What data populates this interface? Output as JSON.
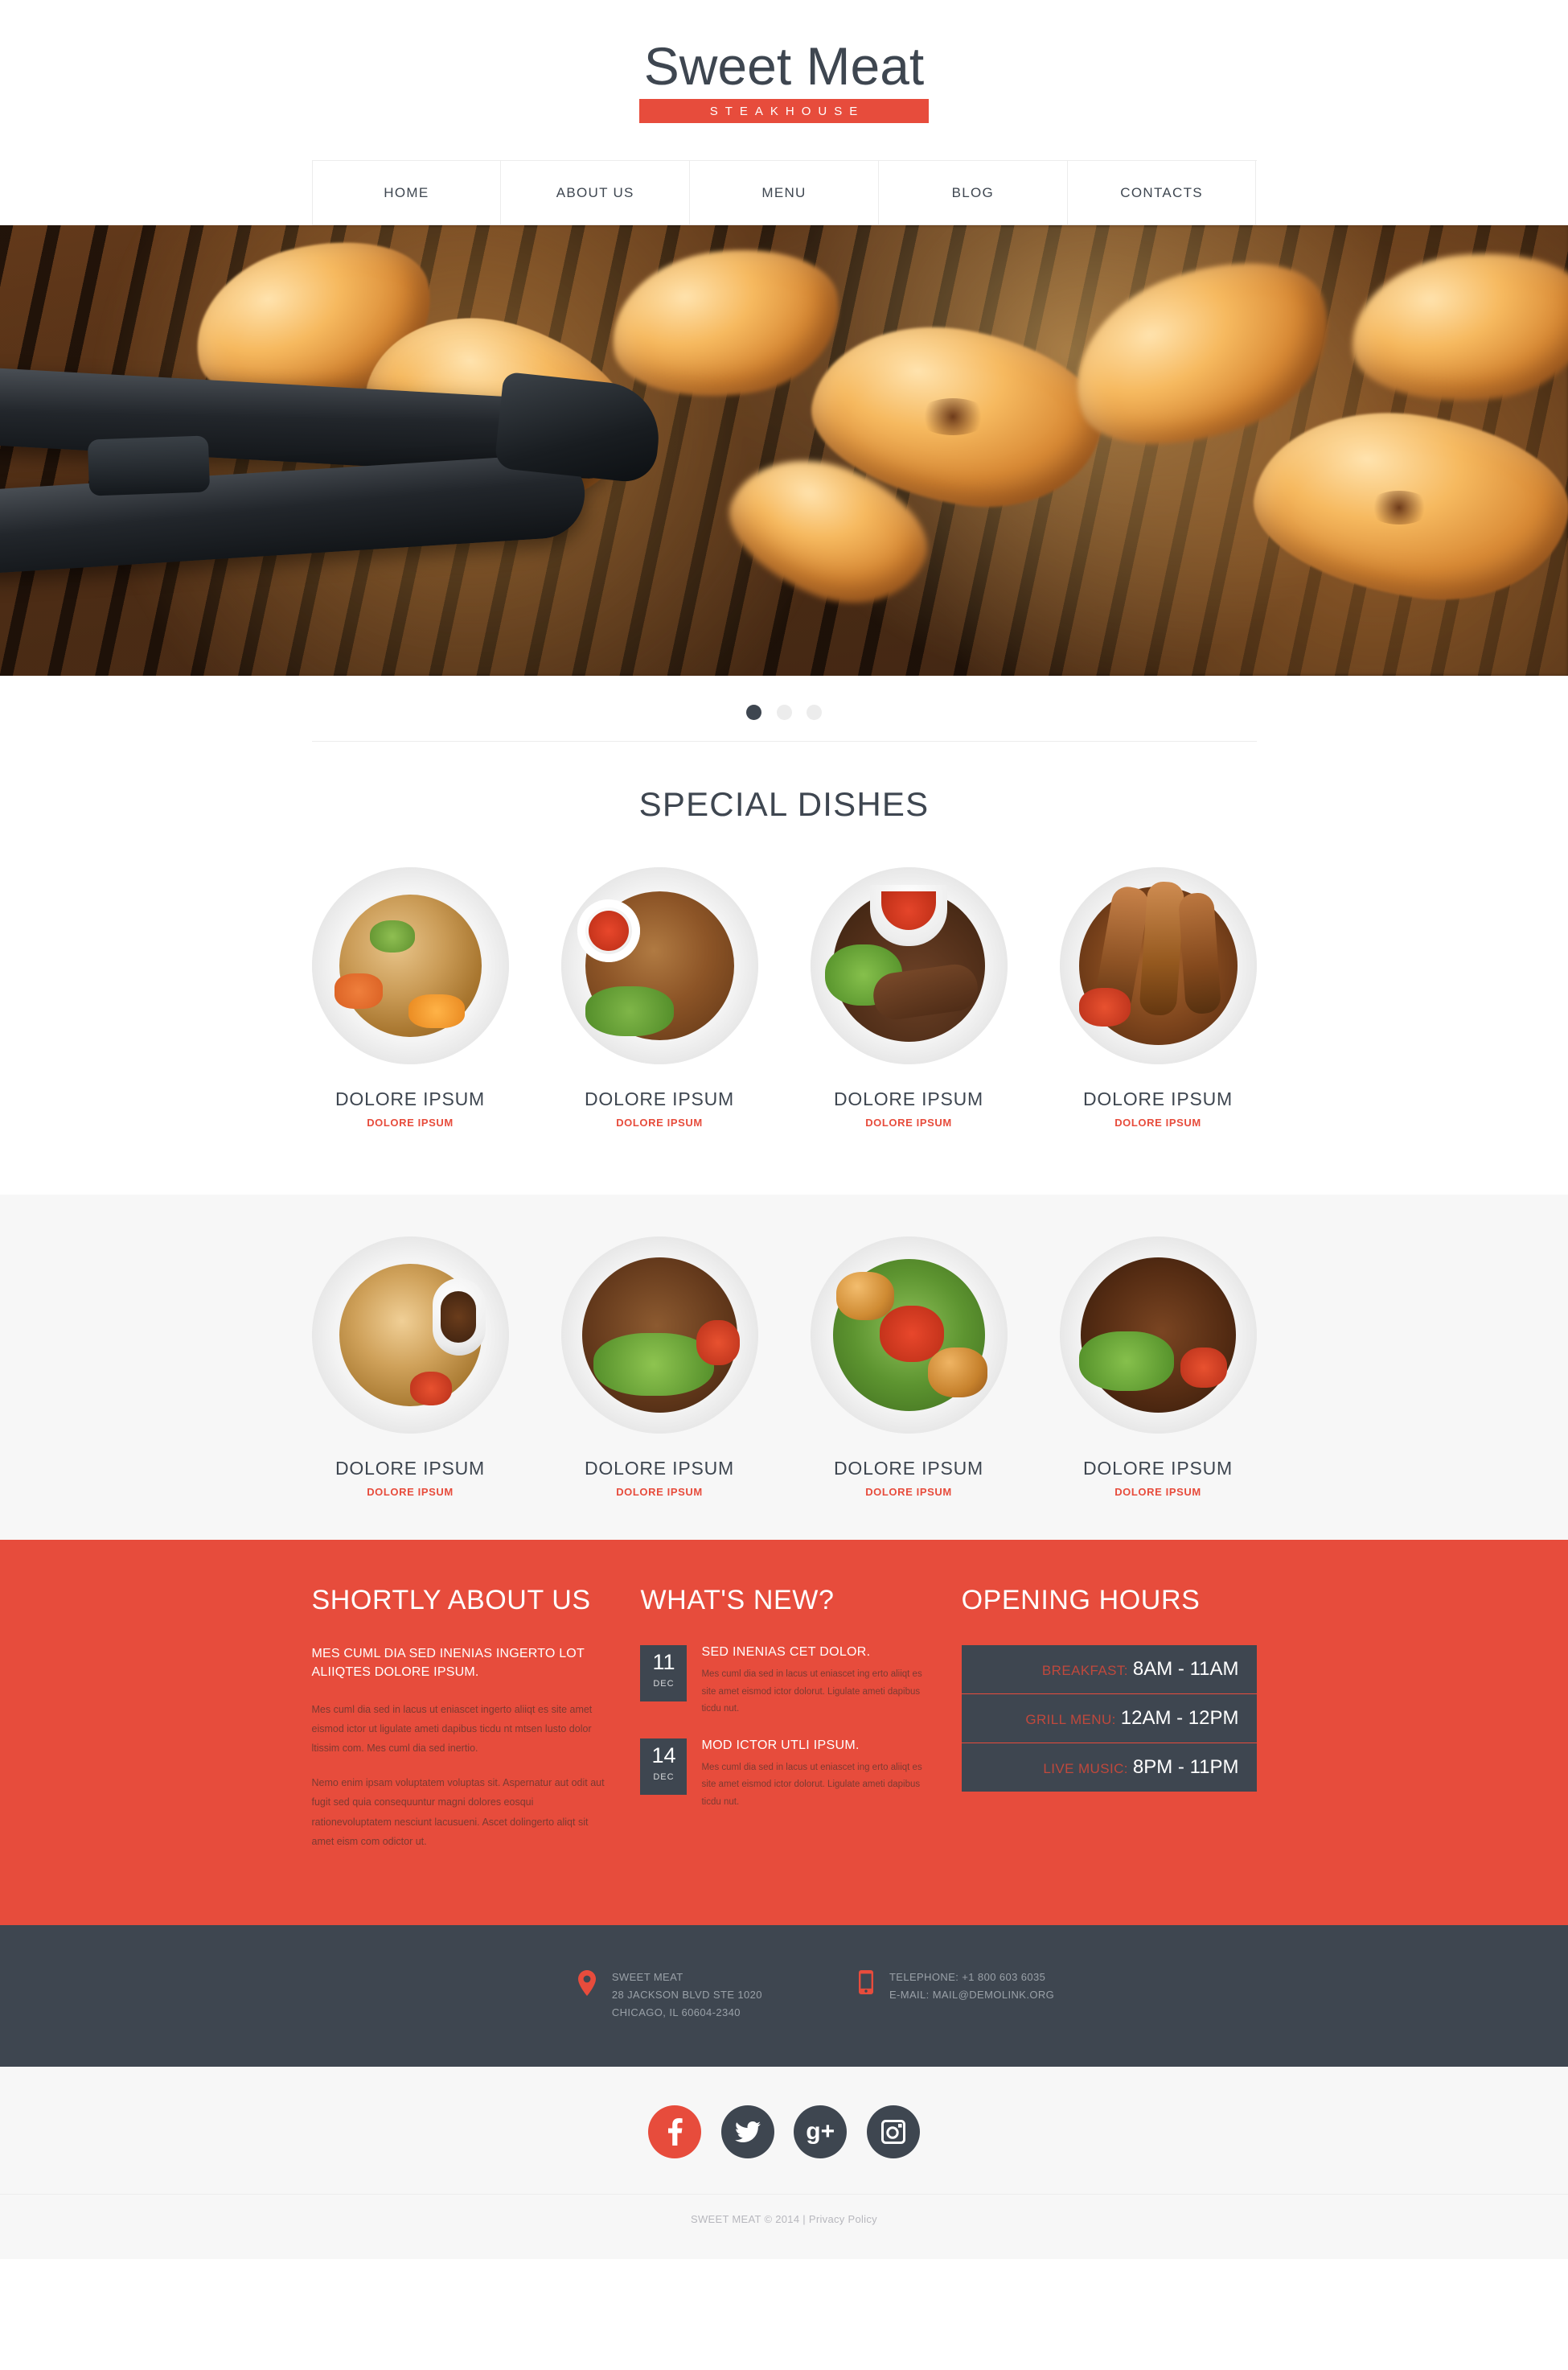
{
  "header": {
    "logo_name": "Sweet Meat",
    "logo_tagline": "STEAKHOUSE"
  },
  "nav": {
    "items": [
      {
        "label": "HOME",
        "active": true
      },
      {
        "label": "ABOUT US",
        "active": false
      },
      {
        "label": "MENU",
        "active": false
      },
      {
        "label": "BLOG",
        "active": false
      },
      {
        "label": "CONTACTS",
        "active": false
      }
    ]
  },
  "slider": {
    "dots": 3,
    "active_dot": 1
  },
  "special_dishes": {
    "title": "SPECIAL DISHES",
    "row_one": [
      {
        "title": "DOLORE IPSUM",
        "subtitle": "DOLORE IPSUM"
      },
      {
        "title": "DOLORE IPSUM",
        "subtitle": "DOLORE IPSUM"
      },
      {
        "title": "DOLORE IPSUM",
        "subtitle": "DOLORE IPSUM"
      },
      {
        "title": "DOLORE IPSUM",
        "subtitle": "DOLORE IPSUM"
      }
    ],
    "row_two": [
      {
        "title": "DOLORE IPSUM",
        "subtitle": "DOLORE IPSUM"
      },
      {
        "title": "DOLORE IPSUM",
        "subtitle": "DOLORE IPSUM"
      },
      {
        "title": "DOLORE IPSUM",
        "subtitle": "DOLORE IPSUM"
      },
      {
        "title": "DOLORE IPSUM",
        "subtitle": "DOLORE IPSUM"
      }
    ]
  },
  "about": {
    "title": "SHORTLY ABOUT US",
    "lead": "MES CUML DIA SED INENIAS INGERTO LOT ALIIQTES DOLORE IPSUM.",
    "paragraph_1": "Mes cuml dia sed in lacus ut eniascet ingerto aliiqt es site amet eismod ictor ut ligulate ameti dapibus ticdu nt mtsen lusto dolor ltissim com. Mes cuml dia sed inertio.",
    "paragraph_2": "Nemo enim ipsam voluptatem voluptas sit. Aspernatur aut odit aut fugit sed quia consequuntur magni dolores eosqui rationevoluptatem nesciunt lacusueni.  Ascet dolingerto aliqt sit amet eism com odictor ut."
  },
  "news": {
    "title": "WHAT'S NEW?",
    "items": [
      {
        "day": "11",
        "month": "DEC",
        "title": "SED INENIAS CET DOLOR.",
        "text": "Mes cuml dia sed in lacus ut eniascet ing erto aliiqt es site amet eismod ictor dolorut. Ligulate ameti dapibus ticdu nut."
      },
      {
        "day": "14",
        "month": "DEC",
        "title": "MOD ICTOR UTLI IPSUM.",
        "text": "Mes cuml dia sed in lacus ut eniascet ing erto aliiqt es site amet eismod ictor dolorut. Ligulate ameti dapibus ticdu nut."
      }
    ]
  },
  "hours": {
    "title": "OPENING HOURS",
    "rows": [
      {
        "label": "BREAKFAST:",
        "value": "8AM - 11AM"
      },
      {
        "label": "GRILL MENU:",
        "value": "12AM - 12PM"
      },
      {
        "label": "LIVE MUSIC:",
        "value": "8PM - 11PM"
      }
    ]
  },
  "footer": {
    "address": {
      "icon": "map-pin-icon",
      "line_1": "SWEET MEAT",
      "line_2": "28 JACKSON BLVD STE 1020",
      "line_3": "CHICAGO, IL 60604-2340"
    },
    "contact": {
      "icon": "mobile-phone-icon",
      "telephone": "TELEPHONE: +1 800 603 6035",
      "email": "E-MAIL: MAIL@DEMOLINK.ORG"
    },
    "social": [
      {
        "name": "facebook",
        "glyph": "f",
        "active": true
      },
      {
        "name": "twitter",
        "glyph": "t",
        "active": false
      },
      {
        "name": "google-plus",
        "glyph": "g+",
        "active": false
      },
      {
        "name": "instagram",
        "glyph": "ig",
        "active": false
      }
    ],
    "copyright": "SWEET MEAT © 2014 | ",
    "privacy_label": "Privacy Policy"
  },
  "colors": {
    "accent": "#e74c3c",
    "dark": "#3e4650",
    "light_bg": "#f7f7f7",
    "muted_text": "#9aa1a8"
  }
}
